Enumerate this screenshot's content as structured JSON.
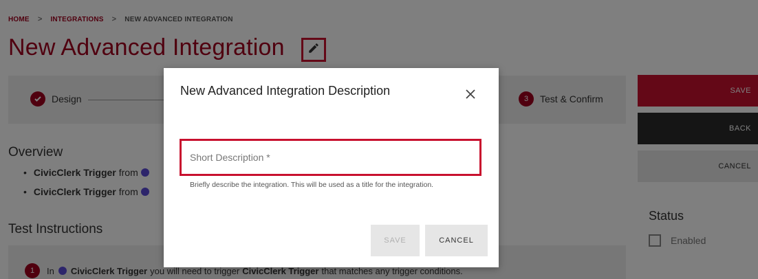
{
  "breadcrumb": {
    "home": "HOME",
    "integrations": "INTEGRATIONS",
    "current": "NEW ADVANCED INTEGRATION",
    "separator": ">"
  },
  "page": {
    "title": "New Advanced Integration",
    "edit_icon": "pencil-icon"
  },
  "stepper": {
    "step1_label": "Design",
    "step3_number": "3",
    "step3_label": "Test & Confirm"
  },
  "overview": {
    "title": "Overview",
    "items": [
      {
        "trigger": "CivicClerk Trigger",
        "from": "from"
      },
      {
        "trigger": "CivicClerk Trigger",
        "from": "from"
      }
    ]
  },
  "test_instructions": {
    "title": "Test Instructions",
    "step_number": "1",
    "line_start": "In",
    "trigger": "CivicClerk Trigger",
    "middle": "you will need to trigger",
    "trigger2": "CivicClerk Trigger",
    "end": "that matches any trigger conditions."
  },
  "side_buttons": {
    "save": "SAVE",
    "back": "BACK",
    "cancel": "CANCEL"
  },
  "status": {
    "title": "Status",
    "enabled_label": "Enabled"
  },
  "modal": {
    "title": "New Advanced Integration Description",
    "input_placeholder": "Short Description *",
    "input_value": "",
    "helper": "Briefly describe the integration. This will be used as a title for the integration.",
    "save": "SAVE",
    "cancel": "CANCEL"
  },
  "colors": {
    "brand": "#a0001e",
    "accent": "#c8102e",
    "dark": "#2a2a2a",
    "logo": "#5b4bd6"
  }
}
